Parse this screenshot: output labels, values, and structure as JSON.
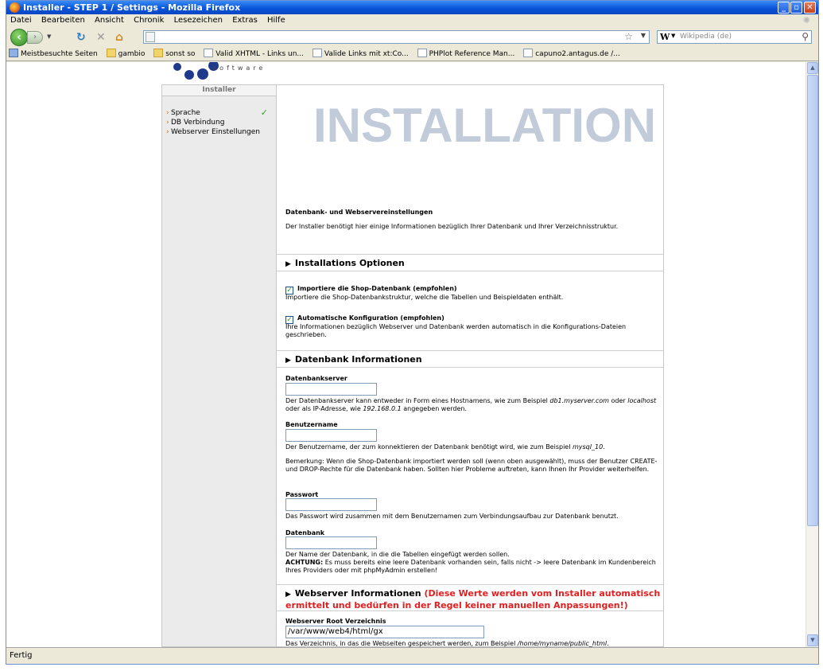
{
  "window": {
    "title": "Installer - STEP 1 / Settings - Mozilla Firefox"
  },
  "menubar": [
    "Datei",
    "Bearbeiten",
    "Ansicht",
    "Chronik",
    "Lesezeichen",
    "Extras",
    "Hilfe"
  ],
  "searchbar": {
    "engine": "W",
    "placeholder": "Wikipedia (de)"
  },
  "bookmarks": [
    {
      "icon": "ms",
      "label": "Meistbesuchte Seiten"
    },
    {
      "icon": "fol",
      "label": "gambio"
    },
    {
      "icon": "fol",
      "label": "sonst so"
    },
    {
      "icon": "pg",
      "label": "Valid XHTML - Links un..."
    },
    {
      "icon": "pg",
      "label": "Valide Links mit xt:Co..."
    },
    {
      "icon": "pg",
      "label": "PHPlot Reference Man..."
    },
    {
      "icon": "pg",
      "label": "capuno2.antagus.de /..."
    }
  ],
  "status": "Fertig",
  "logo": {
    "word": "software"
  },
  "sidebar": {
    "header": "Installer",
    "items": [
      "Sprache",
      "DB Verbindung",
      "Webserver Einstellungen"
    ]
  },
  "main": {
    "title": "INSTALLATION",
    "intro_heading": "Datenbank- und Webservereinstellungen",
    "intro_text": "Der Installer benötigt hier einige Informationen bezüglich Ihrer Datenbank und Ihrer Verzeichnisstruktur.",
    "section1": "Installations Optionen",
    "opt1_label": "Importiere die Shop-Datenbank (empfohlen)",
    "opt1_desc": "Importiere die Shop-Datenbankstruktur, welche die Tabellen und Beispieldaten enthält.",
    "opt2_label": "Automatische Konfiguration (empfohlen)",
    "opt2_desc": "Ihre Informationen bezüglich Webserver und Datenbank werden automatisch in die Konfigurations-Dateien geschrieben.",
    "section2": "Datenbank Informationen",
    "f_server_label": "Datenbankserver",
    "f_server_desc_a": "Der Datenbankserver kann entweder in Form eines Hostnamens, wie zum Beispiel ",
    "f_server_desc_b": "db1.myserver.com",
    "f_server_desc_c": " oder ",
    "f_server_desc_d": "localhost",
    "f_server_desc_e": " oder als IP-Adresse, wie ",
    "f_server_desc_f": "192.168.0.1",
    "f_server_desc_g": " angegeben werden.",
    "f_user_label": "Benutzername",
    "f_user_desc_a": "Der Benutzername, der zum konnektieren der Datenbank benötigt wird, wie zum Beispiel ",
    "f_user_desc_b": "mysql_10",
    "f_user_desc_c": ".",
    "f_user_note": "Bemerkung: Wenn die Shop-Datenbank importiert werden soll (wenn oben ausgewählt), muss der Benutzer CREATE- und DROP-Rechte für die Datenbank haben. Sollten hier Probleme auftreten, kann Ihnen Ihr Provider weiterhelfen.",
    "f_pass_label": "Passwort",
    "f_pass_desc": "Das Passwort wird zusammen mit dem Benutzernamen zum Verbindungsaufbau zur Datenbank benutzt.",
    "f_db_label": "Datenbank",
    "f_db_desc": "Der Name der Datenbank, in die die Tabellen eingefügt werden sollen.",
    "f_db_warn_b": "ACHTUNG:",
    "f_db_warn": " Es muss bereits eine leere Datenbank vorhanden sein, falls nicht -> leere Datenbank im Kundenbereich Ihres Providers oder mit phpMyAdmin erstellen!",
    "section3": "Webserver Informationen",
    "section3_note": "(Diese Werte werden vom Installer automatisch ermittelt und bedürfen in der Regel keiner manuellen Anpassungen!)",
    "f_root_label": "Webserver Root Verzeichnis",
    "f_root_value": "/var/www/web4/html/gx",
    "f_root_desc_a": "Das Verzeichnis, in das die Webseiten gespeichert werden, zum Beispiel ",
    "f_root_desc_b": "/home/myname/public_html",
    "f_root_desc_c": "."
  }
}
